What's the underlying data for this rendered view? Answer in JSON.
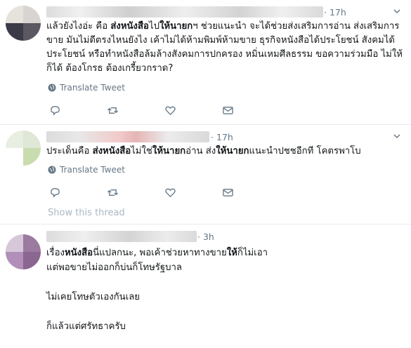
{
  "tweets": [
    {
      "time": "· 17h",
      "body_parts": [
        {
          "t": "แล้วยังไงอ่ะ คือ ",
          "b": false
        },
        {
          "t": "ส่งหนังสือ",
          "b": true
        },
        {
          "t": "ไป",
          "b": false
        },
        {
          "t": "ให้นายก",
          "b": true
        },
        {
          "t": "ฯ ช่วยแนะนำ จะได้ช่วยส่งเสริมการอ่าน ส่งเสริมการขาย มันไม่ดีตรงไหนยังไง เค้าไม่ได้ห้ามพิมพ์ห้ามขาย ธุรกิจหนังสือได้ประโยชน์ สังคมได้ประโยชน์ หรือทำหนังสือล้มล้างสังคมการปกครอง หมิ่นเหมศีลธรรม ขอความร่วมมือ ไม่ให้ก็ได้ ต้องโกรธ ต้องเกรี้ยวกราด?",
          "b": false
        }
      ],
      "translate": "Translate Tweet"
    },
    {
      "time": "· 17h",
      "body_parts": [
        {
          "t": "ประเด็นคือ ",
          "b": false
        },
        {
          "t": "ส่งหนังสือ",
          "b": true
        },
        {
          "t": "ไม่ใช่",
          "b": false
        },
        {
          "t": "ให้นายก",
          "b": true
        },
        {
          "t": "อ่าน ส่ง",
          "b": false
        },
        {
          "t": "ให้นายก",
          "b": true
        },
        {
          "t": "แนะนำปชชอีกที โคตรพาโบ",
          "b": false
        }
      ],
      "translate": "Translate Tweet",
      "show_thread": "Show this thread"
    },
    {
      "time": "· 3h",
      "body_parts": [
        {
          "t": "เรื่อง",
          "b": false
        },
        {
          "t": "หนังสือ",
          "b": true
        },
        {
          "t": "นี่แปลกนะ, พอเค้าช่วยหาทางขาย",
          "b": false
        },
        {
          "t": "ให้",
          "b": true
        },
        {
          "t": "ก็ไม่เอา\nแต่พอขายไม่ออกก็บ่นก็โทษรัฐบาล\n\nไม่เคยโทษตัวเองกันเลย\n\nก็แล้วแต่ศรัทธาครับ",
          "b": false
        }
      ]
    }
  ],
  "icons": {
    "translate": "globe-icon",
    "reply": "reply-icon",
    "retweet": "retweet-icon",
    "like": "heart-icon",
    "dm": "envelope-icon",
    "caret": "chevron-down-icon"
  },
  "colors": {
    "icon_gray": "#657786",
    "divider": "#e6ecf0",
    "show_thread": "#aab8c2"
  }
}
